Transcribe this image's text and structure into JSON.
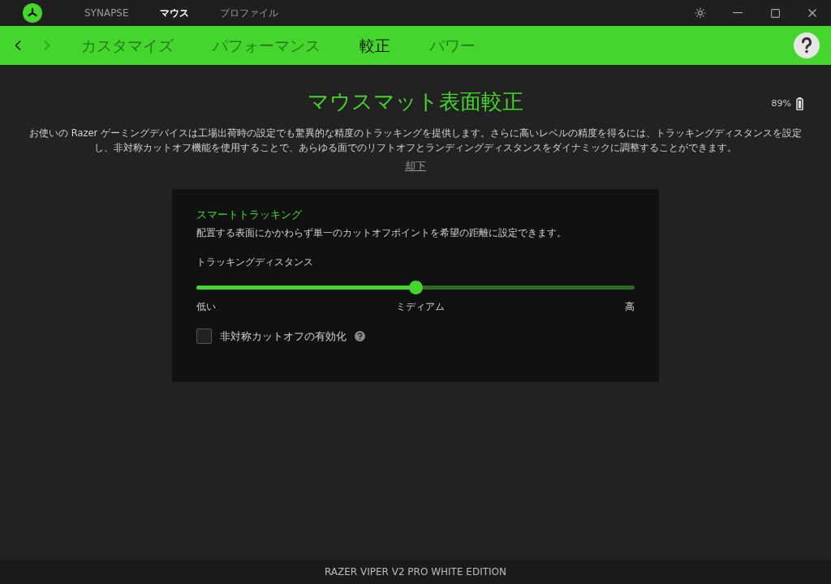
{
  "top_nav": [
    {
      "label": "SYNAPSE",
      "selected": false
    },
    {
      "label": "マウス",
      "selected": true
    },
    {
      "label": "プロファイル",
      "selected": false
    }
  ],
  "sub_tabs": [
    {
      "label": "カスタマイズ",
      "selected": false
    },
    {
      "label": "パフォーマンス",
      "selected": false
    },
    {
      "label": "較正",
      "selected": true
    },
    {
      "label": "パワー",
      "selected": false
    }
  ],
  "page": {
    "title": "マウスマット表面較正",
    "battery": "89%",
    "description": "お使いの Razer ゲーミングデバイスは工場出荷時の設定でも驚異的な精度のトラッキングを提供します。さらに高いレベルの精度を得るには、トラッキングディスタンスを設定し、非対称カットオフ機能を使用することで、あらゆる面でのリフトオフとランディングディスタンスをダイナミックに調整することができます。",
    "dismiss": "却下"
  },
  "card": {
    "title": "スマートトラッキング",
    "subtitle": "配置する表面にかかわらず単一のカットオフポイントを希望の距離に設定できます。",
    "slider": {
      "label": "トラッキングディスタンス",
      "level": 0.5,
      "ticks": [
        "低い",
        "ミディアム",
        "高"
      ]
    },
    "checkbox": {
      "label": "非対称カットオフの有効化",
      "checked": false
    }
  },
  "status_bar": "RAZER VIPER V2 PRO WHITE EDITION"
}
